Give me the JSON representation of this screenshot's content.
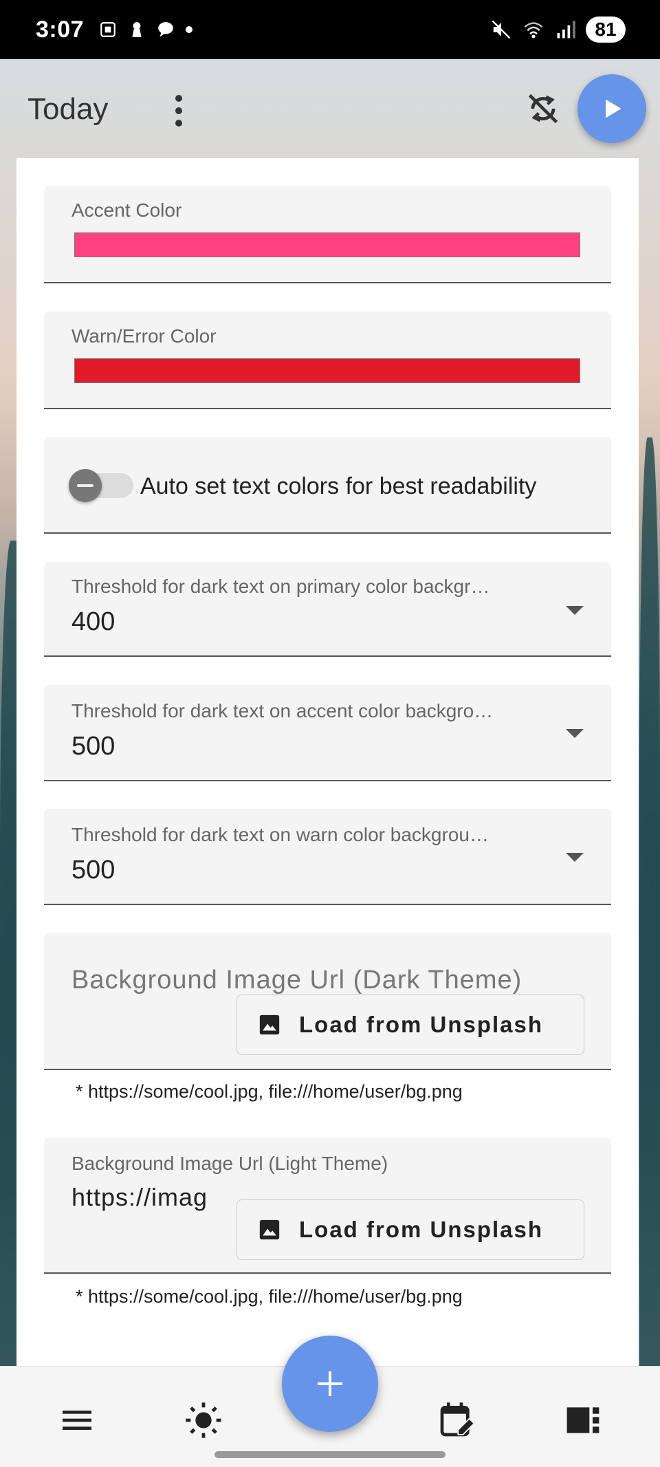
{
  "status_bar": {
    "time": "3:07",
    "battery": "81",
    "signal_label": "5"
  },
  "app_bar": {
    "title": "Today"
  },
  "settings": {
    "accent_color": {
      "label": "Accent Color",
      "color": "#ff4081"
    },
    "warn_color": {
      "label": "Warn/Error Color",
      "color": "#e21b2b"
    },
    "auto_text_colors": {
      "label": "Auto set text colors for best readability",
      "enabled": false
    },
    "threshold_primary": {
      "label": "Threshold for dark text on primary color backgr…",
      "value": "400"
    },
    "threshold_accent": {
      "label": "Threshold for dark text on accent color backgro…",
      "value": "500"
    },
    "threshold_warn": {
      "label": "Threshold for dark text on warn color backgrou…",
      "value": "500"
    },
    "bg_dark": {
      "placeholder": "Background Image Url (Dark Theme)",
      "button_label": "Load from Unsplash",
      "hint": "* https://some/cool.jpg, file:///home/user/bg.png"
    },
    "bg_light": {
      "label": "Background Image Url (Light Theme)",
      "value": "https://imag",
      "button_label": "Load from Unsplash",
      "hint": "* https://some/cool.jpg, file:///home/user/bg.png"
    }
  },
  "bottom_nav": {
    "items": [
      "menu-icon",
      "brightness-icon",
      "add-icon",
      "edit-calendar-icon",
      "view-sidebar-icon"
    ]
  },
  "colors": {
    "fab": "#6594e8",
    "status_bar": "#000000"
  }
}
